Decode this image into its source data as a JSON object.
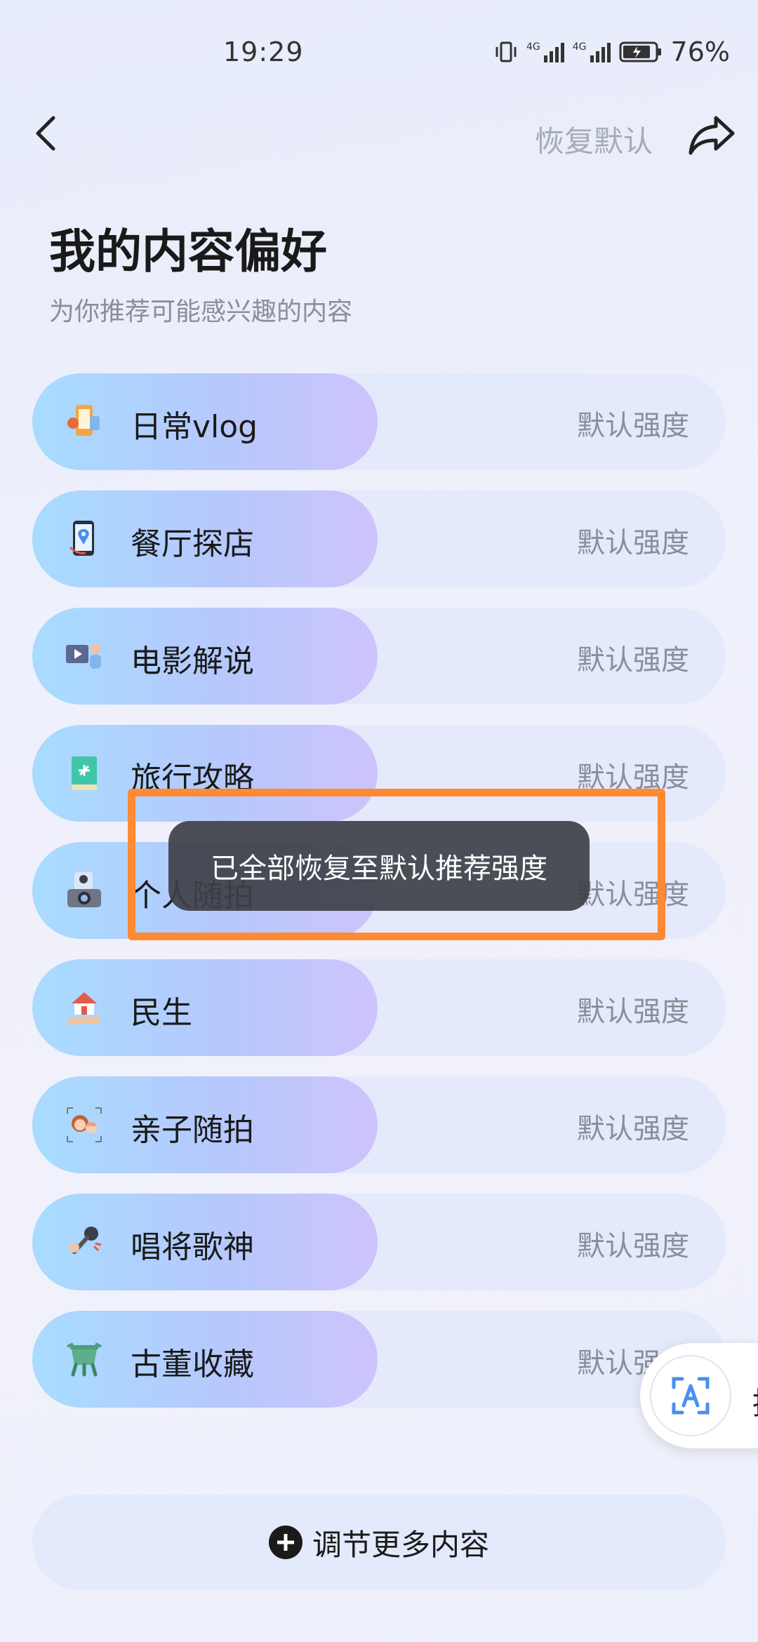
{
  "status_bar": {
    "time": "19:29",
    "network_1": "4G",
    "network_2": "4G",
    "battery": "76%"
  },
  "header": {
    "back_icon": "chevron-left-icon",
    "reset_label": "恢复默认",
    "share_icon": "share-arrow-icon"
  },
  "page": {
    "title": "我的内容偏好",
    "subtitle": "为你推荐可能感兴趣的内容"
  },
  "preferences": [
    {
      "label": "日常vlog",
      "strength": "默认强度",
      "icon": "vlog-icon",
      "color": "#f5a347"
    },
    {
      "label": "餐厅探店",
      "strength": "默认强度",
      "icon": "phone-location-icon",
      "color": "#4a8ff0"
    },
    {
      "label": "电影解说",
      "strength": "默认强度",
      "icon": "movie-presenter-icon",
      "color": "#6b7aa8"
    },
    {
      "label": "旅行攻略",
      "strength": "默认强度",
      "icon": "travel-book-icon",
      "color": "#3fc5a8"
    },
    {
      "label": "个人随拍",
      "strength": "默认强度",
      "icon": "camera-portrait-icon",
      "color": "#7a7f8c"
    },
    {
      "label": "民生",
      "strength": "默认强度",
      "icon": "house-hand-icon",
      "color": "#e45a4a"
    },
    {
      "label": "亲子随拍",
      "strength": "默认强度",
      "icon": "parent-child-icon",
      "color": "#e08a5a"
    },
    {
      "label": "唱将歌神",
      "strength": "默认强度",
      "icon": "microphone-icon",
      "color": "#444"
    },
    {
      "label": "古董收藏",
      "strength": "默认强度",
      "icon": "antique-vessel-icon",
      "color": "#4f9b7c"
    }
  ],
  "toast": {
    "message": "已全部恢复至默认推荐强度"
  },
  "floating_button": {
    "icon": "text-recognition-icon",
    "label": "提"
  },
  "footer": {
    "more_label": "调节更多内容"
  }
}
